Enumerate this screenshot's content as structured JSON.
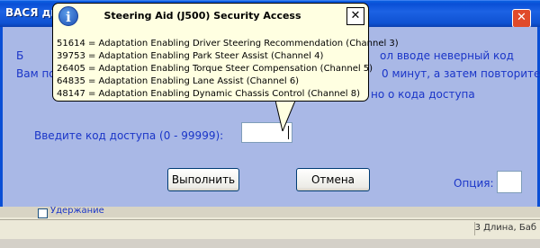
{
  "window": {
    "title": "ВАСЯ диаг",
    "close_glyph": "✕"
  },
  "dialog": {
    "text_lines": [
      "Б",
      "ол вводе неверный код",
      "Вам по",
      "0 минут, а затем повторите",
      "но о кода доступа"
    ],
    "code_label": "Введите код доступа (0 - 99999):",
    "code_value": "",
    "ok_button": "Выполнить",
    "cancel_button": "Отмена",
    "option_label": "Опция:",
    "option_value": ""
  },
  "background_window": {
    "checkbox_label": "Удержание",
    "status_text": "3 Длина, Баб"
  },
  "balloon": {
    "title": "Steering Aid (J500) Security Access",
    "icon": "info-icon",
    "close_glyph": "✕",
    "items": [
      "51614 = Adaptation Enabling Driver Steering Recommendation (Channel 3)",
      "39753 = Adaptation Enabling Park Steer Assist (Channel 4)",
      "26405 = Adaptation Enabling Torque Steer Compensation (Channel 5)",
      "64835 = Adaptation Enabling Lane Assist (Channel 6)",
      "48147 = Adaptation Enabling Dynamic Chassis Control (Channel 8)"
    ]
  },
  "colors": {
    "titlebar": "#0a4fd6",
    "client_bg": "#a9b8e6",
    "text_blue": "#1a35c8",
    "balloon_bg": "#ffffe1"
  }
}
